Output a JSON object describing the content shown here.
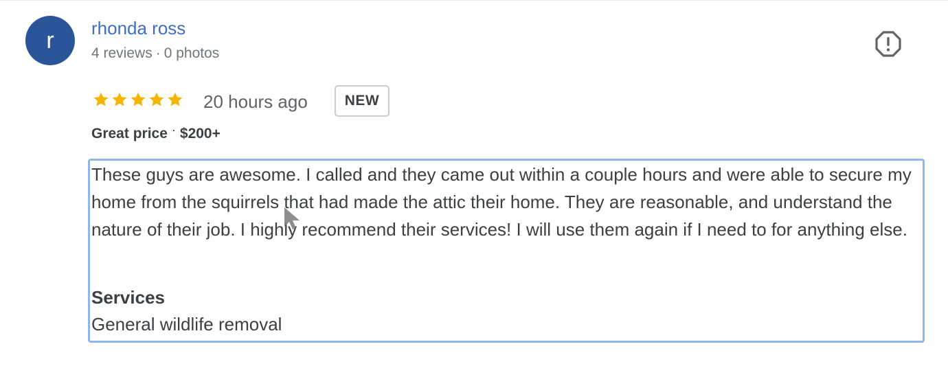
{
  "reviewer": {
    "initial": "r",
    "name": "rhonda ross",
    "reviews": "4 reviews",
    "separator": "·",
    "photos": "0 photos"
  },
  "rating": {
    "stars": 5,
    "time": "20 hours ago",
    "badge": "NEW",
    "star_color": "#f4b400"
  },
  "attributes": {
    "price_label": "Great price",
    "separator": "·",
    "price_range": "$200+"
  },
  "review": {
    "text": "These guys are awesome. I called and they came out within a couple hours and were able to secure my home from the squirrels that had made the attic their home. They are reasonable, and understand the nature of their job. I highly recommend their services! I will use them again if I need to for anything else.",
    "services_heading": "Services",
    "services_value": "General wildlife removal"
  },
  "icons": {
    "flag": "report-flag-icon",
    "cursor": "mouse-cursor-icon"
  },
  "colors": {
    "avatar": "#2a5599",
    "name_link": "#3d6fc4",
    "selection_border": "#8fb8e8"
  }
}
